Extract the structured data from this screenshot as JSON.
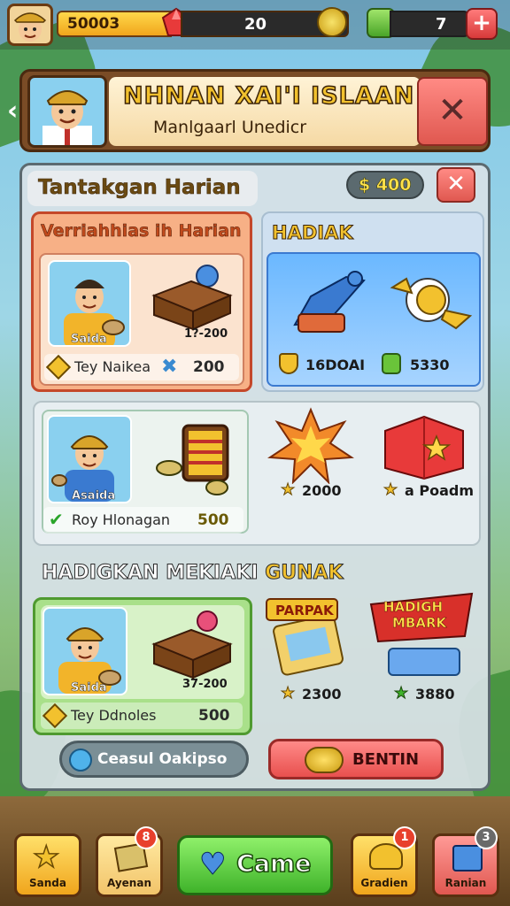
{
  "topbar": {
    "coins": "50003",
    "level": "20",
    "gems": "7",
    "plus_label": "+"
  },
  "header": {
    "title": "NHNAN XAI'I ISLAAN",
    "subtitle": "Manlgaarl Unedicr",
    "close_label": "✕"
  },
  "panel": {
    "title": "Tantakgan Harian",
    "money": "$ 400",
    "close_label": "✕"
  },
  "card_daily": {
    "label": "Verriahhias ih Harian",
    "portrait_caption": "Saida",
    "item_caption": "1?-200",
    "bottom_text": "Tey Naikea",
    "bottom_value": "200"
  },
  "card_hadiah": {
    "label": "HADIAK",
    "left_value": "16DOAI",
    "right_value": "5330"
  },
  "card_mid": {
    "portrait_caption": "Asaida",
    "bottom_text": "Roy Hlonagan",
    "bottom_value": "500",
    "reward1_value": "2000",
    "reward2_value": "a Poadm"
  },
  "section2": {
    "title_main": "HADIGKAN MEKIAKI",
    "title_accent": "GUNAK"
  },
  "card_green": {
    "portrait_caption": "Saida",
    "item_caption": "37-200",
    "bottom_text": "Tey Ddnoles",
    "bottom_value": "500"
  },
  "rewards2": {
    "sign1": "PARPAK",
    "sign2_line1": "HADIGH",
    "sign2_line2": "MBARK",
    "value1": "2300",
    "value2": "3880"
  },
  "buttons": {
    "cancel": "Ceasul Oakipso",
    "claim": "BENTIN"
  },
  "nav": {
    "items": [
      {
        "label": "Sanda"
      },
      {
        "label": "Ayenan",
        "badge": "8"
      },
      {
        "label": "Came"
      },
      {
        "label": "Gradien",
        "badge": "1"
      },
      {
        "label": "Ranian",
        "badge": "3"
      }
    ]
  },
  "colors": {
    "accent_gold": "#f2c12e",
    "danger_red": "#e05850",
    "success_green": "#3fb32a",
    "panel_grey": "#d7e1e6"
  }
}
